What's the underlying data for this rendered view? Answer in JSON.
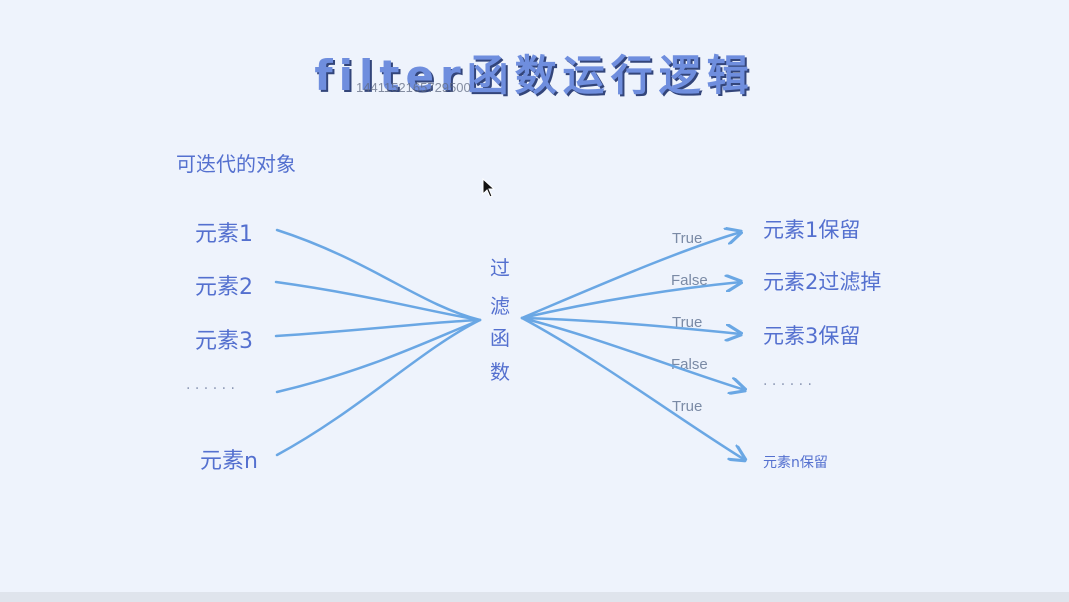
{
  "title": "filter函数运行逻辑",
  "watermark": "1441152165729500",
  "iterable_label": "可迭代的对象",
  "filter_function": [
    "过",
    "滤",
    "函",
    "数"
  ],
  "inputs": [
    "元素1",
    "元素2",
    "元素3",
    "· · · · · ·",
    "元素n"
  ],
  "conditions": [
    "True",
    "False",
    "True",
    "False",
    "True"
  ],
  "outputs": [
    "元素1保留",
    "元素2过滤掉",
    "元素3保留",
    "· · · · · ·",
    "元素n保留"
  ],
  "colors": {
    "text": "#5470cf",
    "line": "#6aa7e4",
    "title": "#6f8ede",
    "label": "#7a8aa5"
  }
}
